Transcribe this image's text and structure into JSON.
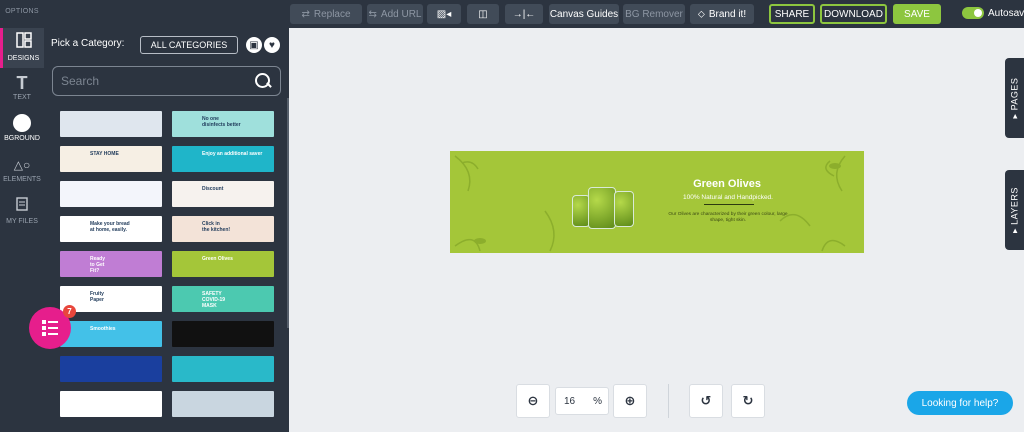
{
  "toolbar": {
    "replace": "Replace",
    "add_url": "Add URL",
    "canvas_guides": "Canvas Guides",
    "bg_remover": "BG Remover",
    "brand_it": "Brand it!",
    "share": "SHARE",
    "download": "DOWNLOAD",
    "save": "SAVE",
    "autosave": "Autosave"
  },
  "rail": {
    "options": "OPTIONS",
    "designs": "DESIGNS",
    "text": "TEXT",
    "background": "BGROUND",
    "elements": "ELEMENTS",
    "my_files": "MY FILES"
  },
  "panel": {
    "pick_label": "Pick a Category:",
    "category": "ALL CATEGORIES",
    "search_placeholder": "Search"
  },
  "thumbnails": [
    {
      "bg": "#dfe6ee",
      "text": ""
    },
    {
      "bg": "#9fe0dc",
      "text": "No one\ndisinfects better"
    },
    {
      "bg": "#f6efe4",
      "text": "STAY HOME"
    },
    {
      "bg": "#1fb5c9",
      "text": "Enjoy an additional saver"
    },
    {
      "bg": "#f3f5fb",
      "text": ""
    },
    {
      "bg": "#f6f2ee",
      "text": "Discount"
    },
    {
      "bg": "#ffffff",
      "text": "Make your bread\nat home, easily."
    },
    {
      "bg": "#f3e3d8",
      "text": "Click in\nthe kitchen!"
    },
    {
      "bg": "#c07dd4",
      "text": "Ready\nto Get\nFit?"
    },
    {
      "bg": "#a4c639",
      "text": "Green Olives"
    },
    {
      "bg": "#ffffff",
      "text": "Fruity\nPaper"
    },
    {
      "bg": "#4cc9b0",
      "text": "SAFETY\nCOVID-19\nMASK"
    },
    {
      "bg": "#43c1e8",
      "text": "Smoothies"
    },
    {
      "bg": "#111111",
      "text": ""
    },
    {
      "bg": "#1a3f9e",
      "text": ""
    },
    {
      "bg": "#29b9c9",
      "text": ""
    },
    {
      "bg": "#ffffff",
      "text": ""
    },
    {
      "bg": "#c9d6e0",
      "text": ""
    }
  ],
  "fab": {
    "badge": "7"
  },
  "banner": {
    "title": "Green Olives",
    "subtitle": "100% Natural and Handpicked.",
    "description": "Our Olives are characterized by their green colour, large shape, tight skin."
  },
  "side_tabs": {
    "pages": "PAGES",
    "layers": "LAYERS"
  },
  "zoom": {
    "value": "16",
    "unit": "%"
  },
  "help": "Looking for help?",
  "colors": {
    "toolbar": "#2c3440",
    "accent": "#8dc63f",
    "pink": "#e61e8c",
    "help": "#1aa6e8"
  }
}
